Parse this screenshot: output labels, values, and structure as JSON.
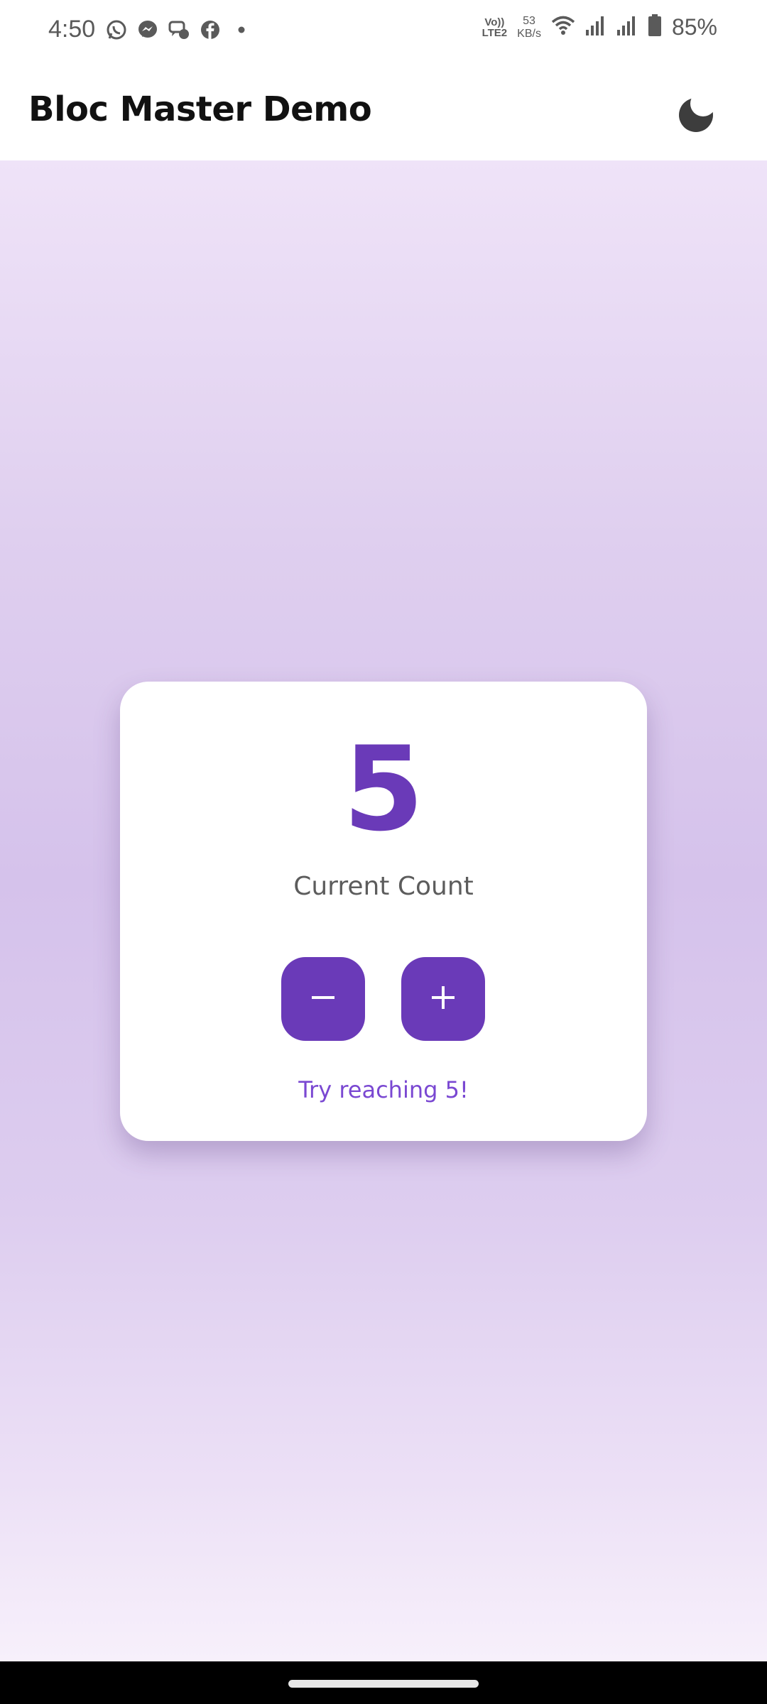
{
  "status_bar": {
    "time": "4:50",
    "notification_icons": [
      "whatsapp-icon",
      "messenger-icon",
      "chat-icon",
      "facebook-icon",
      "dot-icon"
    ],
    "volte_line1": "Vo))",
    "volte_line2": "LTE2",
    "netspeed_value": "53",
    "netspeed_unit": "KB/s",
    "battery": "85%"
  },
  "app_bar": {
    "title": "Bloc Master Demo",
    "theme_toggle_icon": "moon-icon"
  },
  "counter": {
    "value": "5",
    "label": "Current Count",
    "decrement_icon": "minus-icon",
    "increment_icon": "plus-icon",
    "hint": "Try reaching 5!"
  },
  "colors": {
    "accent": "#6a3ab8",
    "hint": "#7a48d2",
    "background_top": "#efe3f8",
    "background_mid": "#d5c2eb"
  }
}
